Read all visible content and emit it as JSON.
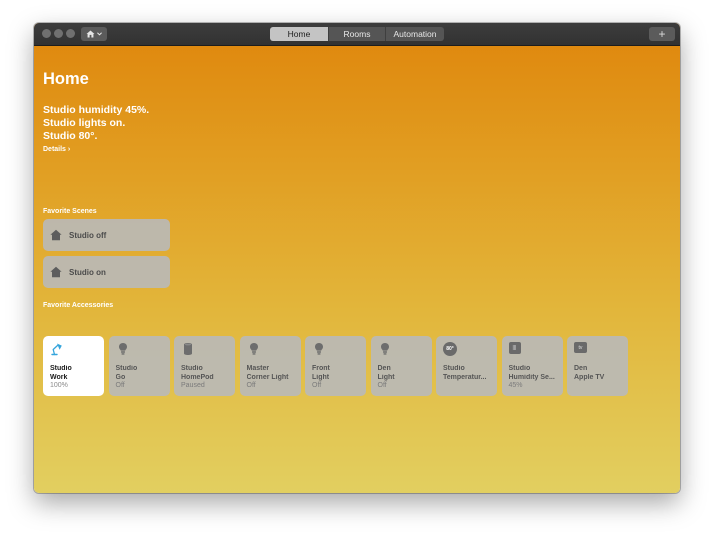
{
  "toolbar": {
    "tabs": [
      {
        "label": "Home",
        "active": true
      },
      {
        "label": "Rooms",
        "active": false
      },
      {
        "label": "Automation",
        "active": false
      }
    ],
    "add_label": "+"
  },
  "home": {
    "title": "Home",
    "status_lines": [
      "Studio humidity 45%.",
      "Studio lights on.",
      "Studio 80°."
    ],
    "details_label": "Details ›"
  },
  "scenes": {
    "header": "Favorite Scenes",
    "items": [
      {
        "label": "Studio off",
        "icon": "house-icon"
      },
      {
        "label": "Studio on",
        "icon": "house-icon"
      }
    ]
  },
  "accessories": {
    "header": "Favorite Accessories",
    "items": [
      {
        "room": "Studio",
        "name": "Work",
        "state": "100%",
        "icon": "desk-lamp-icon",
        "on": true
      },
      {
        "room": "Studio",
        "name": "Go",
        "state": "Off",
        "icon": "lightbulb-icon",
        "on": false
      },
      {
        "room": "Studio",
        "name": "HomePod",
        "state": "Paused",
        "icon": "homepod-icon",
        "on": false
      },
      {
        "room": "Master",
        "name": "Corner Light",
        "state": "Off",
        "icon": "lightbulb-icon",
        "on": false
      },
      {
        "room": "Front",
        "name": "Light",
        "state": "Off",
        "icon": "lightbulb-icon",
        "on": false
      },
      {
        "room": "Den",
        "name": "Light",
        "state": "Off",
        "icon": "lightbulb-icon",
        "on": false
      },
      {
        "room": "Studio",
        "name": "Temperatur...",
        "state": "",
        "icon": "thermometer-badge-icon",
        "badge": "80°",
        "on": false
      },
      {
        "room": "Studio",
        "name": "Humidity Se...",
        "state": "45%",
        "icon": "humidity-sensor-icon",
        "badge": "|||",
        "on": false
      },
      {
        "room": "Den",
        "name": "Apple TV",
        "state": "",
        "icon": "apple-tv-icon",
        "badge": "tv",
        "on": false
      }
    ]
  },
  "colors": {
    "accent_lamp": "#35a5dc",
    "icon_gray": "#6d6d6d"
  }
}
